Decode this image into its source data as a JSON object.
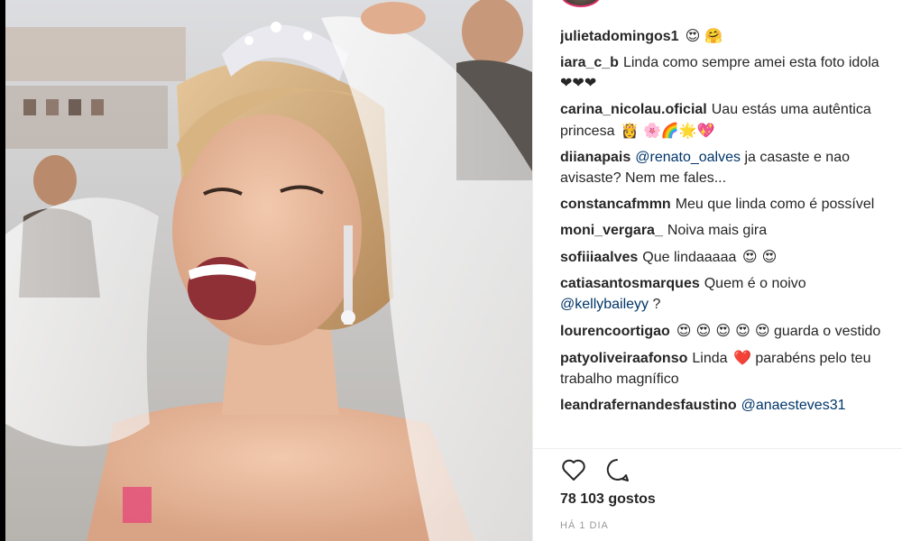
{
  "post": {
    "likes": "78 103 gostos",
    "time": "HÁ 1 DIA"
  },
  "icons": [
    "heart-icon",
    "comment-icon"
  ],
  "colors": {
    "mention": "#003569",
    "heart": "#e0245e",
    "text": "#262626",
    "muted": "#999999"
  },
  "comments": [
    {
      "user": "julietadomingos1",
      "text": "",
      "emoji": "😍 🤗"
    },
    {
      "user": "iara_c_b",
      "text": "Linda como sempre amei esta foto idola ❤❤❤",
      "emoji": ""
    },
    {
      "user": "carina_nicolau.oficial",
      "text": "Uau estás uma autêntica princesa",
      "emoji": "👸 🌸🌈🌟💖"
    },
    {
      "user": "diianapais",
      "mention": "@renato_oalves",
      "text": "ja casaste e nao avisaste? Nem me fales...",
      "emoji": ""
    },
    {
      "user": "constancafmmn",
      "text": "Meu que linda como é possível",
      "emoji": ""
    },
    {
      "user": "moni_vergara_",
      "text": "Noiva mais gira",
      "emoji": ""
    },
    {
      "user": "sofiiiaalves",
      "text": "Que lindaaaaa",
      "emoji": "😍 😍"
    },
    {
      "user": "catiasantosmarques",
      "text": "Quem é o noivo",
      "mention2": "@kellybaileyy",
      "text2": "?",
      "emoji": ""
    },
    {
      "user": "lourencoortigao",
      "text": "",
      "emoji": "😍 😍 😍 😍 😍",
      "text2": "guarda o vestido"
    },
    {
      "user": "patyoliveiraafonso",
      "text": "Linda",
      "emoji": "❤️",
      "text2": "parabéns pelo teu trabalho magnífico"
    },
    {
      "user": "leandrafernandesfaustino",
      "mention": "@anaesteves31",
      "text": "",
      "emoji": ""
    }
  ]
}
